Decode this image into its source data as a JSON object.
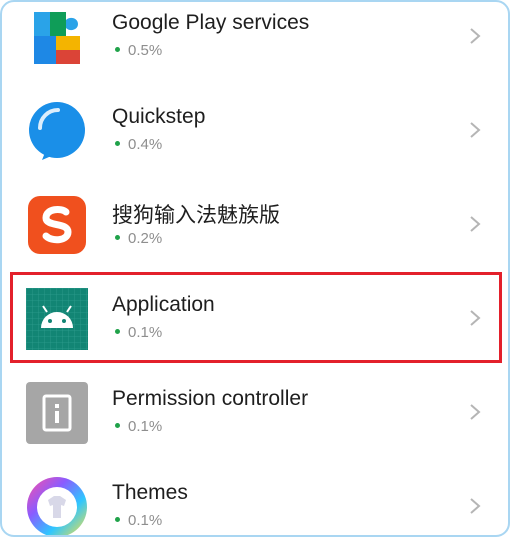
{
  "apps": [
    {
      "name": "Google Play services",
      "usage": "0.5%",
      "icon": "google-play-services-icon"
    },
    {
      "name": "Quickstep",
      "usage": "0.4%",
      "icon": "quickstep-icon"
    },
    {
      "name": "搜狗输入法魅族版",
      "usage": "0.2%",
      "icon": "sogou-input-icon"
    },
    {
      "name": "Application",
      "usage": "0.1%",
      "icon": "android-icon"
    },
    {
      "name": "Permission controller",
      "usage": "0.1%",
      "icon": "permission-controller-icon"
    },
    {
      "name": "Themes",
      "usage": "0.1%",
      "icon": "themes-icon"
    }
  ],
  "highlight": {
    "target": "Application",
    "color": "#e3202b"
  },
  "colors": {
    "usage_dot": "#20a24a",
    "border": "#a9d6f2"
  }
}
